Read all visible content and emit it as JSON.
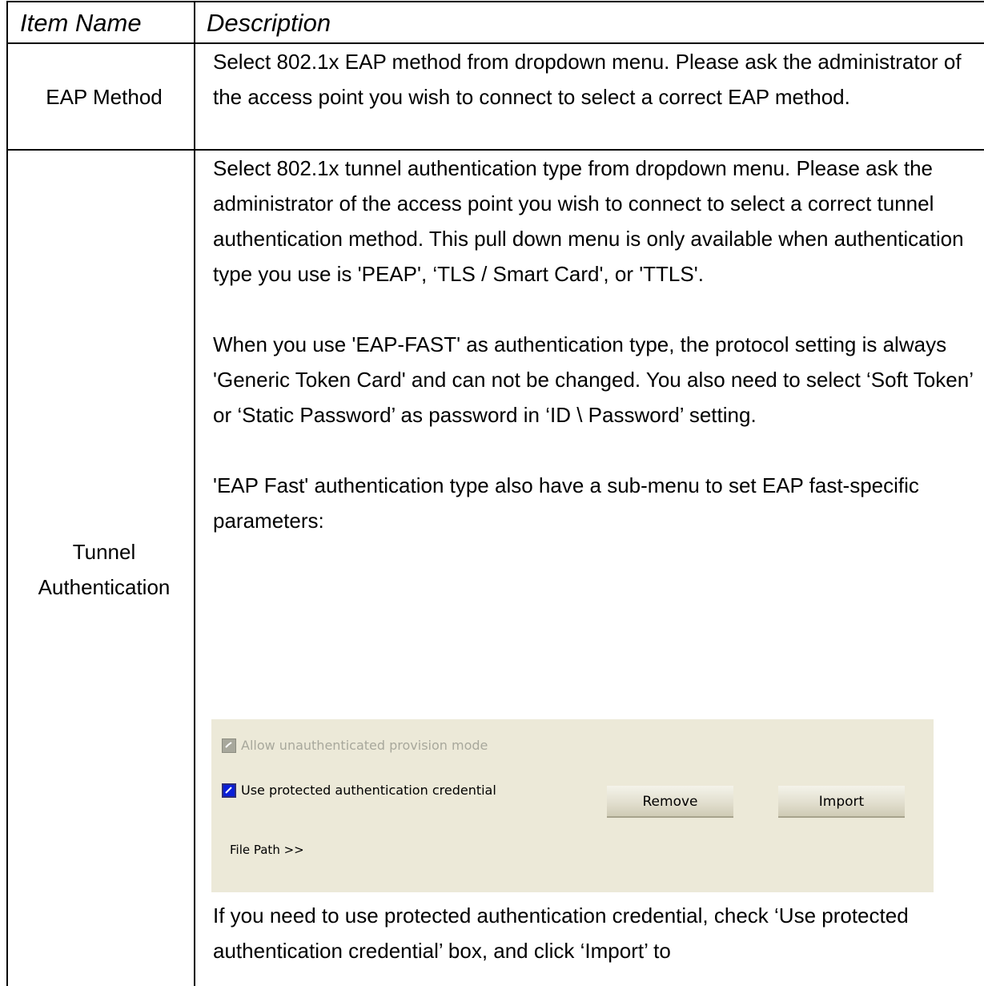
{
  "table": {
    "headers": {
      "item_name": "Item Name",
      "description": "Description"
    },
    "rows": [
      {
        "name": "EAP Method",
        "description": "Select 802.1x EAP method from dropdown menu. Please ask the administrator of the access point you wish to connect to select a correct EAP method."
      },
      {
        "name": "Tunnel Authentication",
        "name_lines": [
          "Tunnel",
          "Authentication"
        ],
        "paragraphs": [
          "Select 802.1x tunnel authentication type from dropdown menu. Please ask the administrator of the access point you wish to connect to select a correct tunnel authentication method. This pull down menu is only available when authentication type you use is 'PEAP', ‘TLS / Smart Card', or 'TTLS'.",
          "When you use 'EAP-FAST' as authentication type, the protocol setting is always 'Generic Token Card' and can not be changed. You also need to select ‘Soft Token’ or ‘Static Password’ as password in ‘ID \\ Password’ setting.",
          "'EAP Fast' authentication type also have a sub-menu to set EAP fast-specific parameters:",
          "If you need to use protected authentication credential, check ‘Use protected authentication credential’ box, and click ‘Import’ to"
        ]
      }
    ]
  },
  "eap_fast_panel": {
    "allow_unauth_label": "Allow unauthenticated provision mode",
    "allow_unauth_checked": true,
    "allow_unauth_enabled": false,
    "use_protected_label": "Use protected authentication credential",
    "use_protected_checked": true,
    "remove_button": "Remove",
    "import_button": "Import",
    "file_path_label": "File Path >>"
  }
}
